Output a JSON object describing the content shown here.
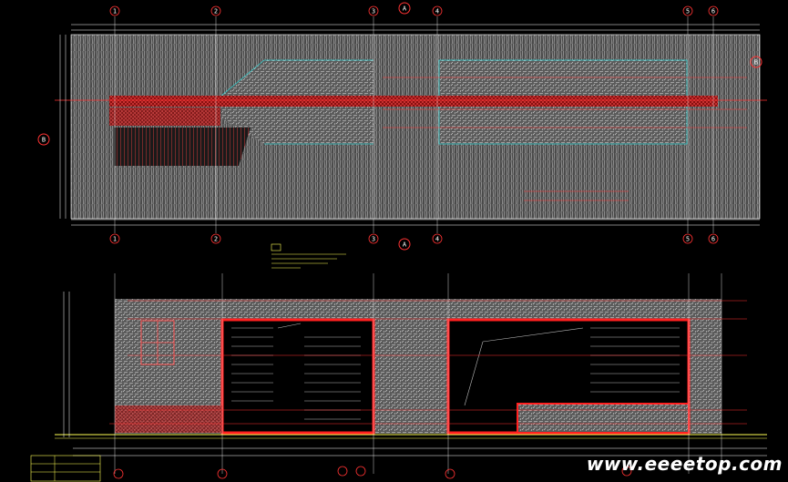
{
  "drawing": {
    "grid_axes_top": [
      "1",
      "2",
      "3",
      "4",
      "5",
      "6"
    ],
    "grid_axes_bottom": [
      "1",
      "2",
      "3",
      "4",
      "5",
      "6"
    ],
    "plan_section_marker": "A",
    "right_section_marker": "B",
    "bottom_section_marker": "A",
    "left_section_marker": "B"
  },
  "watermark": {
    "text": "www.eeeetop.com"
  },
  "colors": {
    "background": "#000000",
    "hatch": "#b9b9b9",
    "accent_red": "#ff2020",
    "dim_line": "#ffffff",
    "grid_circle": "#ff3333",
    "cyan": "#33cccc",
    "yellow": "#ffff55"
  }
}
